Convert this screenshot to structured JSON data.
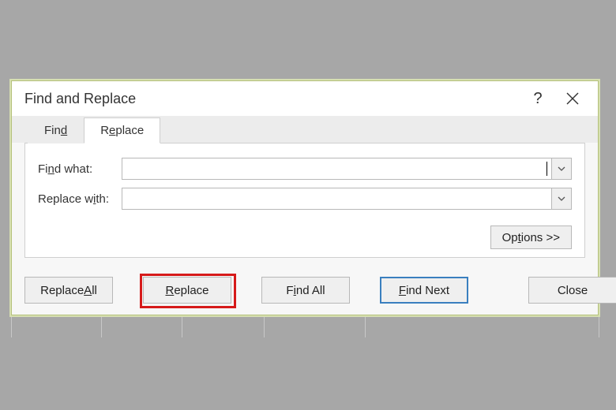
{
  "dialog": {
    "title": "Find and Replace",
    "help_tooltip": "?",
    "tabs": {
      "find": {
        "label_pre": "Fin",
        "label_u": "d",
        "label_post": ""
      },
      "replace": {
        "label_pre": "R",
        "label_u": "e",
        "label_post": "place"
      }
    },
    "fields": {
      "find_what": {
        "label_pre": "Fi",
        "label_u": "n",
        "label_post": "d what:",
        "value": "",
        "placeholder": ""
      },
      "replace_with": {
        "label_pre": "Replace w",
        "label_u": "i",
        "label_post": "th:",
        "value": "",
        "placeholder": ""
      }
    },
    "options_button": {
      "pre": "Op",
      "u": "t",
      "post": "ions >>"
    },
    "buttons": {
      "replace_all": {
        "pre": "Replace ",
        "u": "A",
        "post": "ll"
      },
      "replace": {
        "pre": "",
        "u": "R",
        "post": "eplace"
      },
      "find_all": {
        "pre": "F",
        "u": "i",
        "post": "nd All"
      },
      "find_next": {
        "pre": "",
        "u": "F",
        "post": "ind Next"
      },
      "close": {
        "pre": "Close",
        "u": "",
        "post": ""
      }
    }
  }
}
